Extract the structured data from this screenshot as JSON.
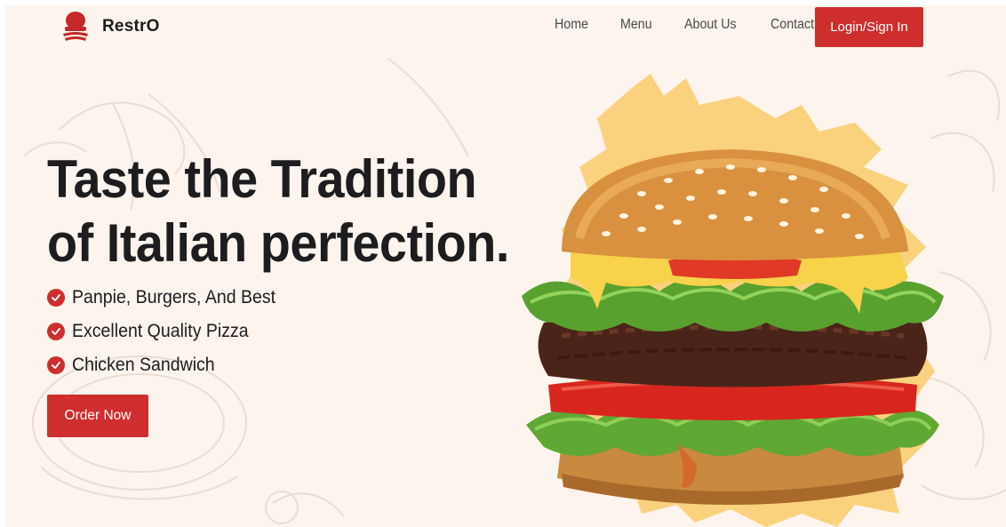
{
  "brand": {
    "name": "RestrO",
    "logo_icon": "chef-hat-logo-icon"
  },
  "nav": {
    "items": [
      {
        "label": "Home"
      },
      {
        "label": "Menu"
      },
      {
        "label": "About Us"
      },
      {
        "label": "Contact"
      }
    ],
    "login_label": "Login/Sign In"
  },
  "hero": {
    "title_line1": "Taste the Tradition",
    "title_line2": "of Italian perfection.",
    "features": [
      {
        "text": "Panpie, Burgers, And Best",
        "icon": "check-circle-icon"
      },
      {
        "text": "Excellent Quality Pizza",
        "icon": "check-circle-icon"
      },
      {
        "text": "Chicken Sandwich",
        "icon": "check-circle-icon"
      }
    ],
    "cta_label": "Order Now",
    "image": "burger-image"
  },
  "colors": {
    "accent": "#cf2e2e",
    "background": "#fdf4ee",
    "text": "#1d1d1f",
    "splash": "#f9cb6a"
  }
}
